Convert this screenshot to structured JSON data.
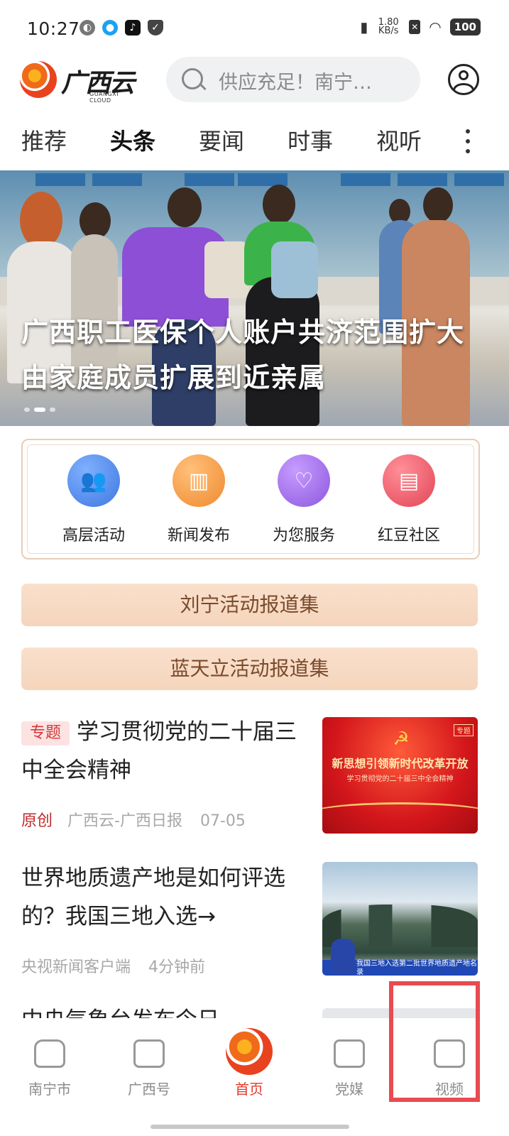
{
  "status_bar": {
    "time": "10:27",
    "net_speed": "1.80 KB/s",
    "battery": "100"
  },
  "header": {
    "logo_text": "广西云",
    "logo_sub": "GUANGXI CLOUD",
    "search_placeholder": "供应充足！南宁…"
  },
  "tabs": [
    {
      "label": "推荐",
      "active": false
    },
    {
      "label": "头条",
      "active": true
    },
    {
      "label": "要闻",
      "active": false
    },
    {
      "label": "时事",
      "active": false
    },
    {
      "label": "视听",
      "active": false
    }
  ],
  "banner": {
    "title": "广西职工医保个人账户共济范围扩大 由家庭成员扩展到近亲属"
  },
  "services": [
    {
      "label": "高层活动",
      "icon": "people-icon",
      "color": "#4f87e6"
    },
    {
      "label": "新闻发布",
      "icon": "building-icon",
      "color": "#f29a43"
    },
    {
      "label": "为您服务",
      "icon": "heart-hand-icon",
      "color": "#9b69e4"
    },
    {
      "label": "红豆社区",
      "icon": "book-icon",
      "color": "#ea5a68"
    }
  ],
  "reports": [
    {
      "label": "刘宁活动报道集"
    },
    {
      "label": "蓝天立活动报道集"
    }
  ],
  "news": [
    {
      "tag": "专题",
      "headline": "学习贯彻党的二十届三中全会精神",
      "original": "原创",
      "source": "广西云-广西日报",
      "time": "07-05",
      "thumb_title": "新思想引领新时代改革开放",
      "thumb_sub": "学习贯彻党的二十届三中全会精神",
      "thumb_badge": "专题"
    },
    {
      "headline": "世界地质遗产地是如何评选的？我国三地入选→",
      "source": "央视新闻客户端",
      "time": "4分钟前",
      "thumb_caption": "我国三地入选第二批世界地质遗产地名录"
    },
    {
      "headline": "中央气象台发布今日…"
    }
  ],
  "bottom_nav": [
    {
      "label": "南宁市",
      "icon": "city-icon"
    },
    {
      "label": "广西号",
      "icon": "chat-icon"
    },
    {
      "label": "首页",
      "icon": "home-logo-icon",
      "active": true
    },
    {
      "label": "党媒",
      "icon": "calendar-icon"
    },
    {
      "label": "视频",
      "icon": "video-icon"
    }
  ],
  "colors": {
    "accent": "#e33a2c",
    "highlight_box": "#e84b50",
    "report_bg": "#f7dac3"
  }
}
